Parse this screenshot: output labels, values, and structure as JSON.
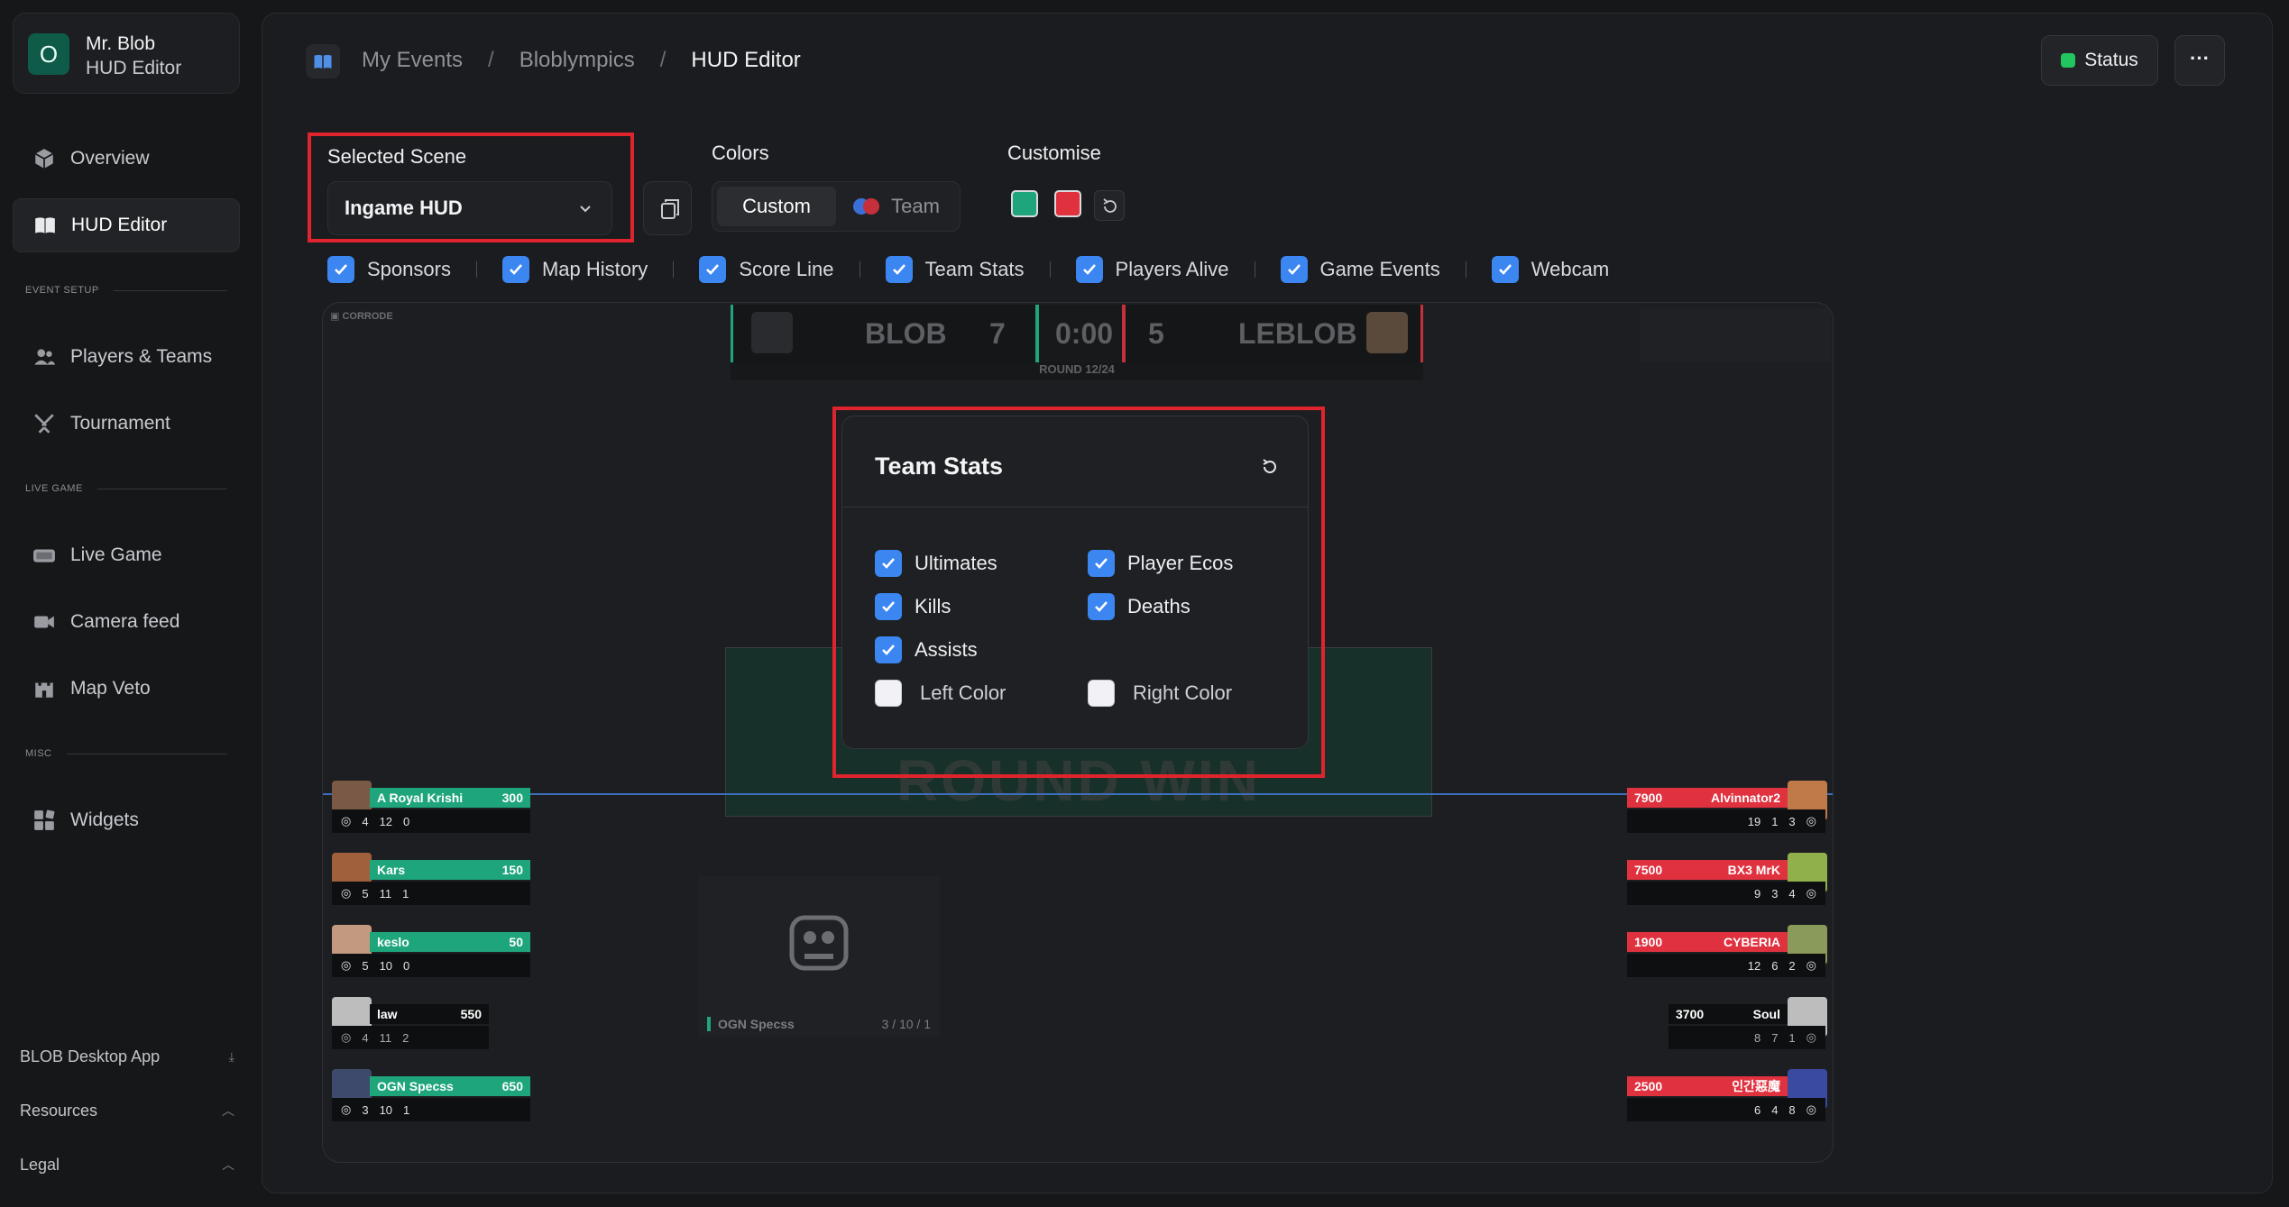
{
  "user": {
    "initial": "O",
    "name": "Mr. Blob",
    "role": "HUD Editor"
  },
  "nav": {
    "overview": "Overview",
    "hud_editor": "HUD Editor",
    "section_event_setup": "EVENT SETUP",
    "players_teams": "Players & Teams",
    "tournament": "Tournament",
    "section_live_game": "LIVE GAME",
    "live_game": "Live Game",
    "camera_feed": "Camera feed",
    "map_veto": "Map Veto",
    "section_misc": "MISC",
    "widgets": "Widgets"
  },
  "footer": {
    "desktop_app": "BLOB Desktop App",
    "resources": "Resources",
    "legal": "Legal"
  },
  "breadcrumb": {
    "item1": "My Events",
    "item2": "Bloblympics",
    "current": "HUD Editor",
    "separator": "/"
  },
  "header": {
    "status_label": "Status",
    "status_color": "#22c55e",
    "more_label": "···"
  },
  "scene": {
    "label": "Selected Scene",
    "value": "Ingame HUD"
  },
  "colors": {
    "label": "Colors",
    "options": [
      "Custom",
      "Team"
    ],
    "selected": "Custom"
  },
  "customise": {
    "label": "Customise",
    "left_color": "#1fa57c",
    "right_color": "#e0313f"
  },
  "toggles": [
    {
      "label": "Sponsors",
      "checked": true
    },
    {
      "label": "Map History",
      "checked": true
    },
    {
      "label": "Score Line",
      "checked": true
    },
    {
      "label": "Team Stats",
      "checked": true
    },
    {
      "label": "Players Alive",
      "checked": true
    },
    {
      "label": "Game Events",
      "checked": true
    },
    {
      "label": "Webcam",
      "checked": true
    }
  ],
  "hud": {
    "sponsor": "▣ CORRODE",
    "team_left": "BLOB",
    "score_left": "7",
    "timer": "0:00",
    "score_right": "5",
    "team_right": "LEBLOB",
    "round": "ROUND 12/24",
    "round_win": "ROUND WIN",
    "webcam_player": "OGN Specss",
    "webcam_stats": "3 / 10 / 1",
    "left_players": [
      {
        "name": "A Royal Krishi",
        "credits": "300",
        "k": "4",
        "d": "12",
        "a": "0"
      },
      {
        "name": "Kars",
        "credits": "150",
        "k": "5",
        "d": "11",
        "a": "1"
      },
      {
        "name": "keslo",
        "credits": "50",
        "k": "5",
        "d": "10",
        "a": "0"
      },
      {
        "name": "law",
        "credits": "550",
        "k": "4",
        "d": "11",
        "a": "2"
      },
      {
        "name": "OGN Specss",
        "credits": "650",
        "k": "3",
        "d": "10",
        "a": "1"
      }
    ],
    "right_players": [
      {
        "name": "Alvinnator2",
        "credits": "7900",
        "k": "19",
        "d": "1",
        "a": "3"
      },
      {
        "name": "BX3 MrK",
        "credits": "7500",
        "k": "9",
        "d": "3",
        "a": "4"
      },
      {
        "name": "CYBERIA",
        "credits": "1900",
        "k": "12",
        "d": "6",
        "a": "2"
      },
      {
        "name": "Soul",
        "credits": "3700",
        "k": "8",
        "d": "7",
        "a": "1"
      },
      {
        "name": "인간惡魔",
        "credits": "2500",
        "k": "6",
        "d": "4",
        "a": "8"
      }
    ]
  },
  "team_stats": {
    "title": "Team Stats",
    "options": [
      {
        "label": "Ultimates",
        "checked": true
      },
      {
        "label": "Player Ecos",
        "checked": true
      },
      {
        "label": "Kills",
        "checked": true
      },
      {
        "label": "Deaths",
        "checked": true
      },
      {
        "label": "Assists",
        "checked": true
      }
    ],
    "left_color_label": "Left Color",
    "right_color_label": "Right Color"
  }
}
